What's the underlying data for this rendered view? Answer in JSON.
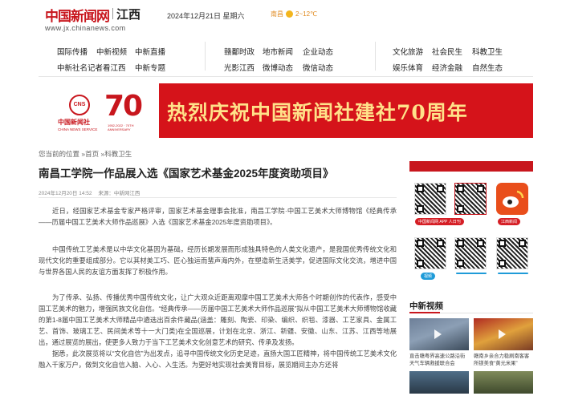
{
  "header": {
    "logo_cn": "中国新闻网",
    "logo_region": "江西",
    "logo_url": "www.jx.chinanews.com",
    "date": "2024年12月21日 星期六",
    "weather": "南昌",
    "weather_temp": "2~12℃"
  },
  "nav": {
    "col1_row1": [
      "国际传播",
      "中新视频",
      "中新直播"
    ],
    "col1_row2": [
      "中新社名记者看江西",
      "中新专题"
    ],
    "col2_row1": [
      "赣鄱时政",
      "地市新闻",
      "企业动态"
    ],
    "col2_row2": [
      "光影江西",
      "微博动态",
      "微信动态"
    ],
    "col3_row1": [
      "文化旅游",
      "社会民生",
      "科教卫生"
    ],
    "col3_row2": [
      "娱乐体育",
      "经济金融",
      "自然生态"
    ]
  },
  "banner": {
    "cns_emblem": "CNS",
    "cns_name": "中国新闻社",
    "cns_en": "CHINA NEWS SERVICE",
    "anniv_num": "70",
    "anniv_years": "1952-2022 · 70TH ANNIVERSARY",
    "slogan": "热烈庆祝中国新闻社建社70周年"
  },
  "breadcrumb": {
    "prefix": "您当前的位置",
    "sep": " »",
    "home": "首页",
    "section": "科教卫生"
  },
  "article": {
    "title": "南昌工学院一作品展入选《国家艺术基金2025年度资助项目》",
    "date": "2024年12月20日 14:52",
    "source": "来源：中新网江西",
    "paragraphs": [
      "近日，经国家艺术基金专家严格评审，国家艺术基金理事会批准，南昌工学院·中国工艺美术大师博物馆《经典传承——历届中国工艺美术大师作品巡展》入选《国家艺术基金2025年度资助项目》。",
      "中国传统工艺美术是以中华文化基因为基础，经历长期发展而形成独具特色的人类文化遗产，是我国优秀传统文化和现代文化的重要组成部分。它以其材美工巧、匠心独运而蜚声海内外，在塑造新生活美学，促进国际文化交流，增进中国与世界各国人民的友谊方面发挥了积极作用。",
      "为了传承、弘扬、传播优秀中国传统文化，让广大观众近距离观摩中国工艺美术大师各个时期创作的代表作，感受中国工艺美术的魅力，增强民族文化自信。“经典传承——历届中国工艺美术大师作品巡展”拟从中国工艺美术大师博物馆收藏的第1-8届中国工艺美术大师精品中遴选出百余件藏品(涵盖：雕刻、陶瓷、印染、编织、织毯、漆器、工艺家具、金属工艺、首饰、玻璃工艺、民间美术等十一大门类)在全国巡展，计划在北京、浙江、新疆、安徽、山东、江苏、江西等地展出，通过展览的展出，使更多人致力于当下工艺美术文化创意艺术的研究、传承及发扬。",
      "据悉，此次展览将以“文化自信”为出发点，追寻中国传统文化历史足迹，直扬大国工匠精神，将中国传统工艺美术文化融入千家万户，做到文化自信入脑、入心、入生活。为更好地实现社会美育目标，展览期间主办方还将"
    ]
  },
  "sidebar": {
    "qr_captions": [
      "中国新闻网 APP 人日刊",
      "",
      "江西新闻",
      "视频",
      "",
      ""
    ],
    "video_heading": "中新视频",
    "videos": [
      {
        "caption": "直击赣粤界高速公路沿街天气车辆救援联合会"
      },
      {
        "caption": "赣南乡亲合力稳刷南客客所镁美食“黄元米果”"
      }
    ]
  }
}
